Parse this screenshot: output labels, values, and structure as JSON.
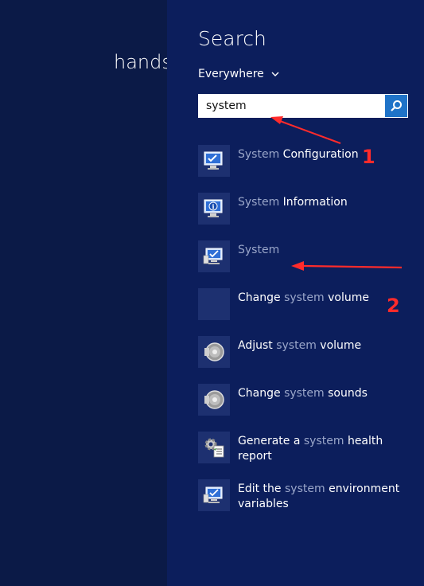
{
  "desktop": {
    "partial_text": "hands"
  },
  "search_panel": {
    "title": "Search",
    "scope": "Everywhere",
    "query": "system"
  },
  "results": [
    {
      "parts": [
        {
          "t": "System",
          "dim": true
        },
        {
          "t": " Configuration",
          "dim": false
        }
      ],
      "icon": "system-configuration-icon"
    },
    {
      "parts": [
        {
          "t": "System",
          "dim": true
        },
        {
          "t": " Information",
          "dim": false
        }
      ],
      "icon": "system-information-icon"
    },
    {
      "parts": [
        {
          "t": "System",
          "dim": true
        }
      ],
      "icon": "system-computer-icon"
    },
    {
      "parts": [
        {
          "t": "Change ",
          "dim": false
        },
        {
          "t": "system",
          "dim": true
        },
        {
          "t": " volume",
          "dim": false
        }
      ],
      "icon": "blank-tile-icon"
    },
    {
      "parts": [
        {
          "t": "Adjust ",
          "dim": false
        },
        {
          "t": "system",
          "dim": true
        },
        {
          "t": " volume",
          "dim": false
        }
      ],
      "icon": "speaker-icon"
    },
    {
      "parts": [
        {
          "t": "Change ",
          "dim": false
        },
        {
          "t": "system",
          "dim": true
        },
        {
          "t": " sounds",
          "dim": false
        }
      ],
      "icon": "speaker-icon"
    },
    {
      "parts": [
        {
          "t": "Generate a ",
          "dim": false
        },
        {
          "t": "system",
          "dim": true
        },
        {
          "t": " health report",
          "dim": false
        }
      ],
      "icon": "gear-checklist-icon"
    },
    {
      "parts": [
        {
          "t": "Edit the ",
          "dim": false
        },
        {
          "t": "system",
          "dim": true
        },
        {
          "t": " environment variables",
          "dim": false
        }
      ],
      "icon": "system-computer-icon"
    }
  ],
  "annotations": {
    "marker_1": "1",
    "marker_2": "2"
  },
  "colors": {
    "panel_bg": "#0c1e5c",
    "desktop_bg": "#0b1a47",
    "accent_button": "#1f73c8",
    "dim_text": "#9aa6c9",
    "annotation_red": "#ff2b2b"
  }
}
